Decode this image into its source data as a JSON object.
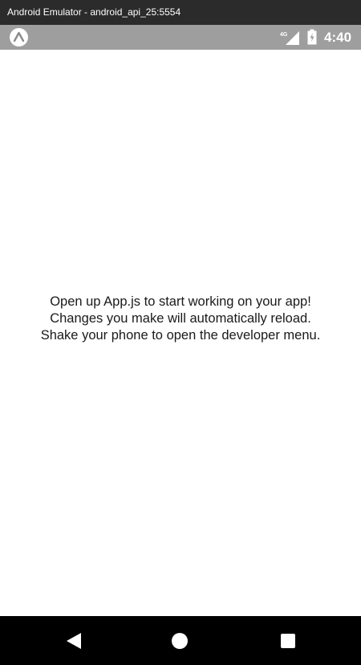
{
  "window": {
    "title": "Android Emulator - android_api_25:5554"
  },
  "status_bar": {
    "network": "4G",
    "time": "4:40",
    "background_color": "#9e9e9e",
    "icons": [
      "expo-icon",
      "signal-icon",
      "battery-charging-icon"
    ]
  },
  "content": {
    "lines": [
      "Open up App.js to start working on your app!",
      "Changes you make will automatically reload.",
      "Shake your phone to open the developer menu."
    ]
  },
  "navigation": {
    "icons": [
      "back-icon",
      "home-icon",
      "recents-icon"
    ],
    "background_color": "#000000"
  }
}
